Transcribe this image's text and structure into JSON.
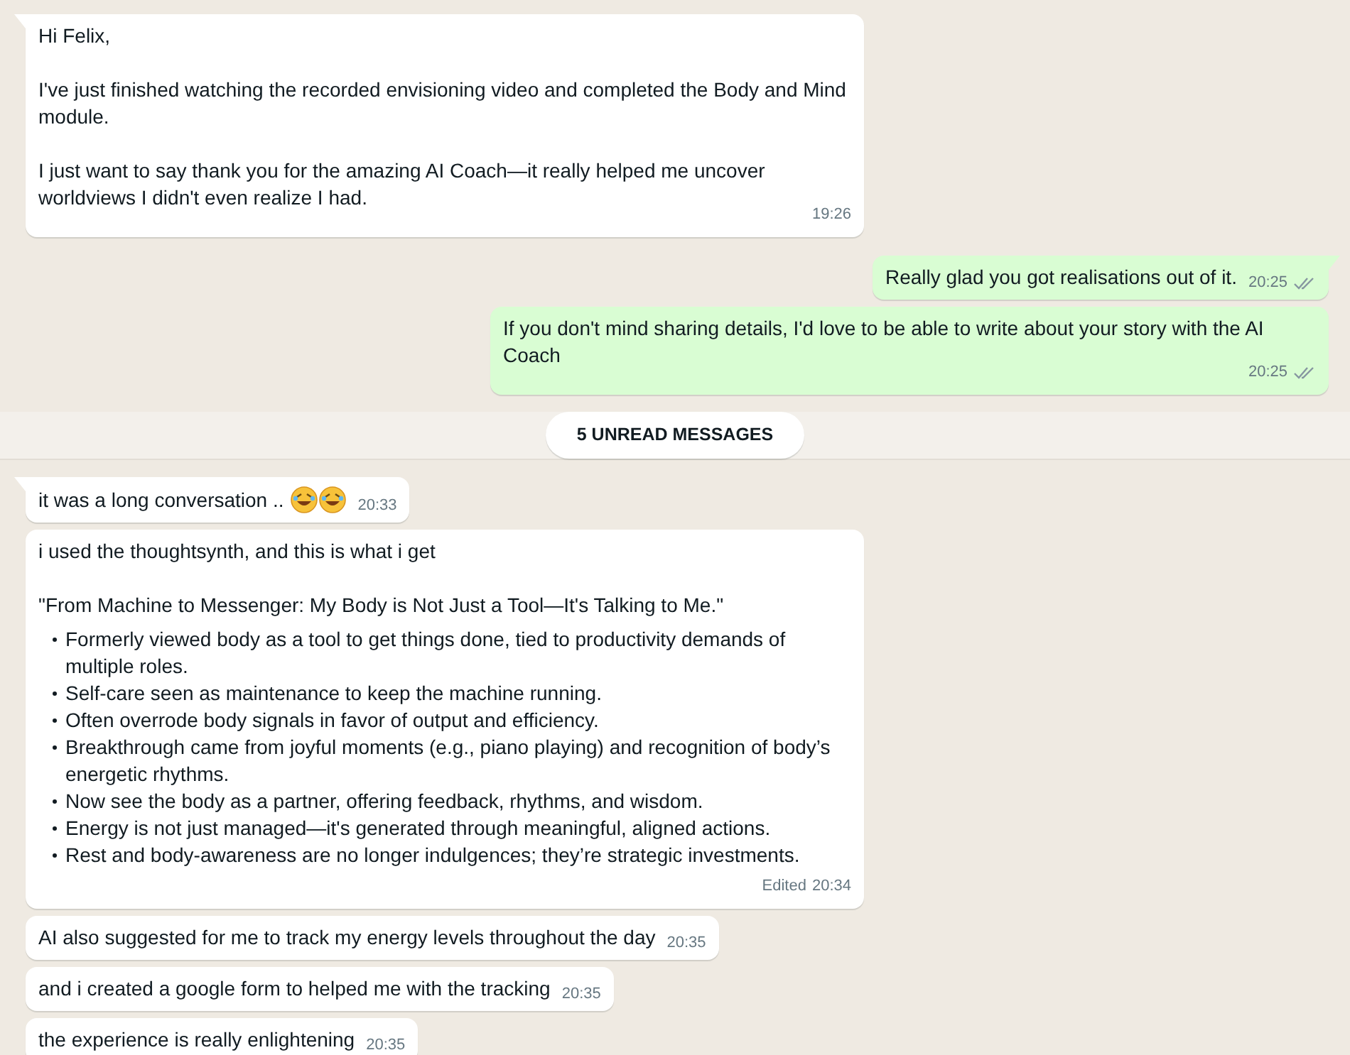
{
  "messages_before": [
    {
      "outgoing": false,
      "kind": "text",
      "paragraphs": [
        "Hi Felix,",
        "I've just finished watching the recorded envisioning video and completed the Body and Mind module.",
        "I just want to say thank you for the amazing AI Coach—it really helped me uncover worldviews I didn't even realize I had."
      ],
      "time": "19:26",
      "tail": true
    },
    {
      "outgoing": true,
      "kind": "text",
      "paragraphs": [
        "Really glad you got realisations out of it."
      ],
      "time": "20:25",
      "read": false,
      "tail": true
    },
    {
      "outgoing": true,
      "kind": "text",
      "paragraphs": [
        "If you don't mind sharing details, I'd love to be able to write about your story with the AI Coach"
      ],
      "time": "20:25",
      "read": false,
      "tail": false
    }
  ],
  "unread_divider": "5 UNREAD MESSAGES",
  "messages_after": [
    {
      "outgoing": false,
      "kind": "emoji_text",
      "paragraphs": [
        "it was a long conversation .."
      ],
      "time": "20:33",
      "tail": true
    },
    {
      "outgoing": false,
      "kind": "text",
      "paragraphs": [
        "i used the thoughtsynth, and this is what i get",
        "\"From Machine to Messenger: My Body is Not Just a Tool—It's Talking to Me.\""
      ],
      "bullets": [
        "Formerly viewed body as a tool to get things done, tied to productivity demands of multiple roles.",
        "Self-care seen as maintenance to keep the machine running.",
        "Often overrode body signals in favor of output and efficiency.",
        "Breakthrough came from joyful moments (e.g., piano playing) and recognition of body’s energetic rhythms.",
        "Now see the body as a partner, offering feedback, rhythms, and wisdom.",
        "Energy is not just managed—it's generated through meaningful, aligned actions.",
        "Rest and body-awareness are no longer indulgences; they’re strategic investments."
      ],
      "edited_label": "Edited",
      "time": "20:34",
      "tail": false
    },
    {
      "outgoing": false,
      "kind": "text",
      "paragraphs": [
        "AI also suggested for me to track my energy levels throughout the day"
      ],
      "time": "20:35",
      "tail": false
    },
    {
      "outgoing": false,
      "kind": "text",
      "paragraphs": [
        "and i created a google form to helped me with the tracking"
      ],
      "time": "20:35",
      "tail": false
    },
    {
      "outgoing": false,
      "kind": "text",
      "paragraphs": [
        "the experience is really enlightening"
      ],
      "time": "20:35",
      "tail": false
    }
  ]
}
